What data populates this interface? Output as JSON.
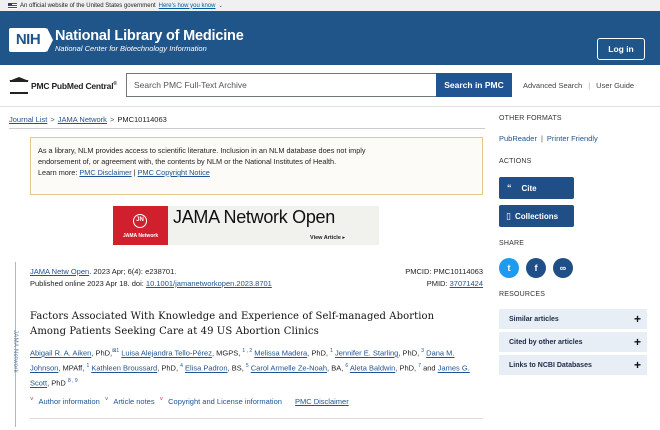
{
  "gov_banner": {
    "text": "An official website of the United States government",
    "link": "Here's how you know",
    "chevron": "⌄"
  },
  "header": {
    "logo": "NIH",
    "title": "National Library of Medicine",
    "subtitle": "National Center for Biotechnology Information",
    "login_label": "Log in"
  },
  "search": {
    "logo_text": "PMC PubMed Central",
    "logo_tm": "®",
    "placeholder": "Search PMC Full-Text Archive",
    "button_label": "Search in PMC",
    "advanced_label": "Advanced Search",
    "sep": "|",
    "guide_label": "User Guide"
  },
  "breadcrumb": {
    "items": [
      "Journal List",
      "JAMA Network",
      "PMC10114063"
    ],
    "sep": ">"
  },
  "notice": {
    "line1": "As a library, NLM provides access to scientific literature. Inclusion in an NLM database does not imply",
    "line2": "endorsement of, or agreement with, the contents by NLM or the National Institutes of Health.",
    "learn_more": "Learn more:",
    "disclaimer_link": "PMC Disclaimer",
    "sep": "|",
    "copyright_link": "PMC Copyright Notice"
  },
  "journal_banner": {
    "title": "JAMA Network Open",
    "brand": "JAMA Network",
    "icon": "JN",
    "view_label": "View Article ▸"
  },
  "article": {
    "journal": "JAMA Netw Open",
    "citation": ". 2023 Apr; 6(4): e238701.",
    "published": "Published online 2023 Apr 18. doi: ",
    "doi": "10.1001/jamanetworkopen.2023.8701",
    "pmcid": "PMCID: PMC10114063",
    "pmid_label": "PMID: ",
    "pmid": "37071424",
    "side_label": "JAMA Network",
    "title": "Factors Associated With Knowledge and Experience of Self-managed Abortion Among Patients Seeking Care at 49 US Abortion Clinics"
  },
  "authors": [
    {
      "name": "Abigail R. A. Aiken",
      "deg": ", PhD,",
      "sup": "⊠1"
    },
    {
      "name": "Luisa Alejandra Tello-Pérez",
      "deg": ", MGPS, ",
      "sup": "1 , 2"
    },
    {
      "name": "Melissa Madera",
      "deg": ", PhD, ",
      "sup": "1"
    },
    {
      "name": "Jennifer E. Starling",
      "deg": ", PhD, ",
      "sup": "3"
    },
    {
      "name": "Dana M. Johnson",
      "deg": ", MPAff, ",
      "sup": "1"
    },
    {
      "name": "Kathleen Broussard",
      "deg": ", PhD, ",
      "sup": "4"
    },
    {
      "name": "Elisa Padron",
      "deg": ", BS, ",
      "sup": "5"
    },
    {
      "name": "Carol Armelle Ze-Noah",
      "deg": ", BA, ",
      "sup": "6"
    },
    {
      "name": "Aleta Baldwin",
      "deg": ", PhD, ",
      "sup": "7"
    },
    {
      "name": "James G. Scott",
      "deg": ", PhD ",
      "sup": "8 , 9"
    }
  ],
  "authors_and": " and ",
  "article_links": {
    "arrow": "˅",
    "author_info": "Author information",
    "article_notes": "Article notes",
    "copyright": "Copyright and License information",
    "disclaimer": "PMC Disclaimer"
  },
  "sidebar": {
    "other_formats": "OTHER FORMATS",
    "pubreader": "PubReader",
    "sep": "|",
    "printer": "Printer Friendly",
    "actions": "ACTIONS",
    "cite_label": "Cite",
    "cite_icon": "“",
    "collections_label": "Collections",
    "collections_icon": "▯",
    "share": "SHARE",
    "share_icons": {
      "twitter": "t",
      "facebook": "f",
      "link": "∞"
    },
    "resources": "RESOURCES",
    "plus": "+",
    "resource_items": [
      "Similar articles",
      "Cited by other articles",
      "Links to NCBI Databases"
    ]
  }
}
